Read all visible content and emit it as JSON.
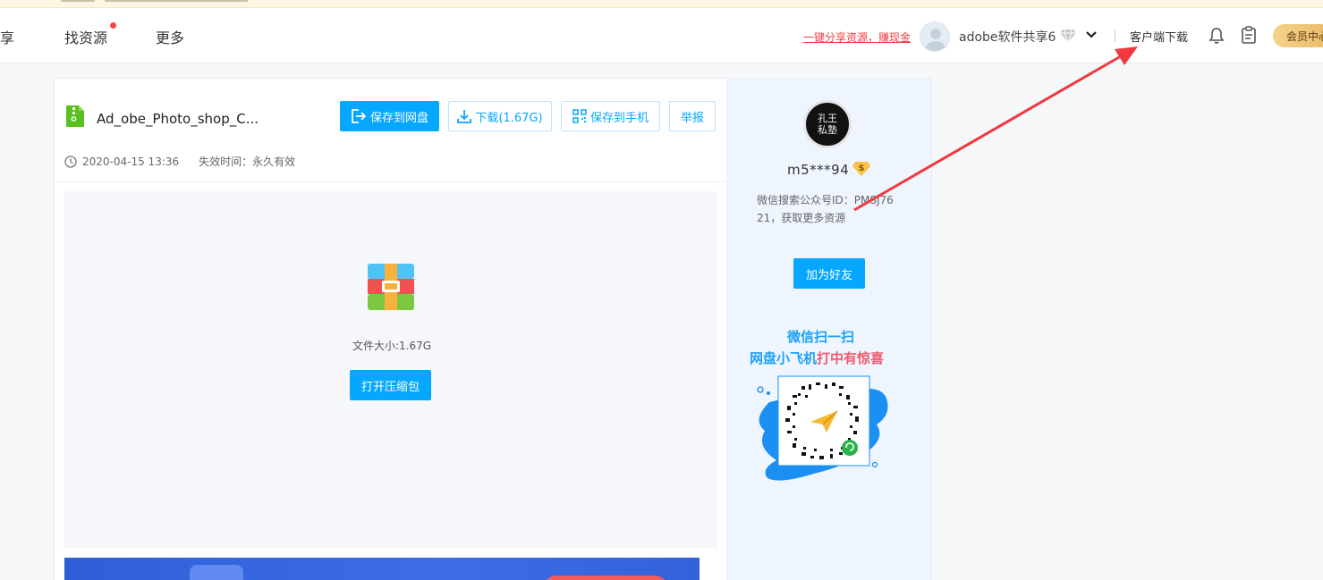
{
  "header": {
    "nav": [
      {
        "label": "享"
      },
      {
        "label": "找资源"
      },
      {
        "label": "更多"
      }
    ],
    "share_link": "一键分享资源，赚现金",
    "username": "adobe软件共享6",
    "client_download": "客户端下载",
    "vip_center": "会员中心"
  },
  "file": {
    "name": "Ad_obe_Photo_shop_C...",
    "buttons": {
      "save_to_disk": "保存到网盘",
      "download": "下载(1.67G)",
      "save_to_phone": "保存到手机",
      "report": "举报"
    },
    "date": "2020-04-15 13:36",
    "expiry": "失效时间：永久有效",
    "size_label": "文件大小:1.67G",
    "open_zip": "打开压缩包"
  },
  "uploader": {
    "avatar_text": "孔王私塾",
    "name": "m5***94",
    "description": "微信搜索公众号ID：PMSJ7621，获取更多资源",
    "add_friend": "加为好友"
  },
  "promo": {
    "line1": "微信扫一扫",
    "line2_blue": "网盘小飞机",
    "line2_red": "打中有惊喜"
  },
  "colors": {
    "primary": "#06a7ff",
    "accent_red": "#f0393f",
    "vip_gold": "#e9b866"
  }
}
